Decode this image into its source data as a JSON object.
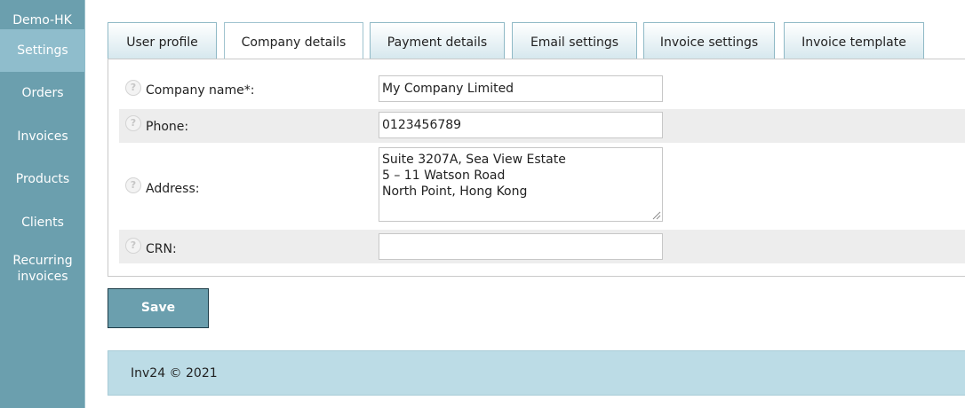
{
  "sidebar": {
    "brand": "Demo-HK",
    "items": [
      {
        "label": "Settings"
      },
      {
        "label": "Orders"
      },
      {
        "label": "Invoices"
      },
      {
        "label": "Products"
      },
      {
        "label": "Clients"
      },
      {
        "label_line1": "Recurring",
        "label_line2": "invoices"
      }
    ]
  },
  "tabs": [
    {
      "label": "User profile"
    },
    {
      "label": "Company details"
    },
    {
      "label": "Payment details"
    },
    {
      "label": "Email settings"
    },
    {
      "label": "Invoice settings"
    },
    {
      "label": "Invoice template"
    }
  ],
  "active_tab": "Company details",
  "form": {
    "help_glyph": "?",
    "company_name": {
      "label": "Company name*:",
      "value": "My Company Limited"
    },
    "phone": {
      "label": "Phone:",
      "value": "0123456789"
    },
    "address": {
      "label": "Address:",
      "value": "Suite 3207A, Sea View Estate\n5 – 11 Watson Road\nNorth Point, Hong Kong"
    },
    "crn": {
      "label": "CRN:",
      "value": ""
    }
  },
  "save_label": "Save",
  "footer": "Inv24 © 2021",
  "colors": {
    "sidebar": "#6b9fae",
    "sidebar_active": "#8fbdcc",
    "footer": "#bcdce6",
    "row_shade": "#ededed"
  }
}
